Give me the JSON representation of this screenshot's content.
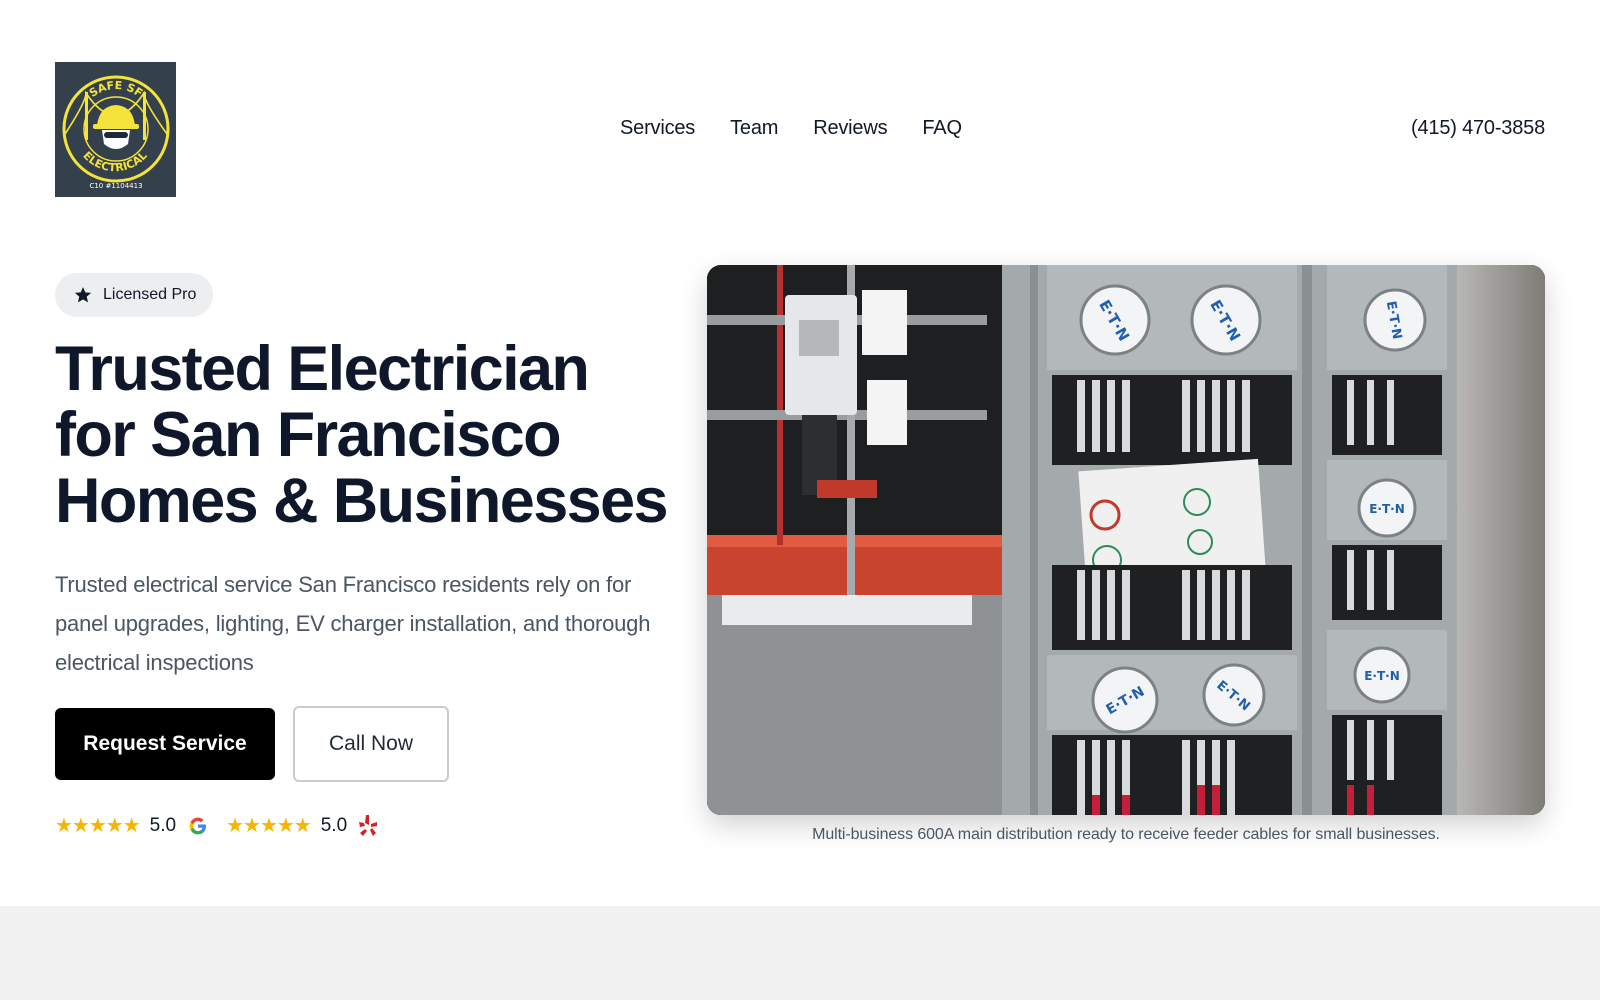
{
  "header": {
    "logo": {
      "top_text": "SAFE SF",
      "bottom_text": "ELECTRICAL",
      "license": "C10 #1104413"
    },
    "nav": [
      {
        "label": "Services"
      },
      {
        "label": "Team"
      },
      {
        "label": "Reviews"
      },
      {
        "label": "FAQ"
      }
    ],
    "phone": "(415) 470-3858"
  },
  "hero": {
    "badge": "Licensed Pro",
    "headline_lines": [
      "Trusted Electrician",
      "for San Francisco",
      "Homes & Businesses"
    ],
    "subtext": "Trusted electrical service San Francisco residents rely on for panel upgrades, lighting, EV charger installation, and thorough electrical inspections",
    "primary_button": "Request Service",
    "secondary_button": "Call Now",
    "ratings": [
      {
        "stars": "★★★★★",
        "score": "5.0",
        "source_icon": "google-icon"
      },
      {
        "stars": "★★★★★",
        "score": "5.0",
        "source_icon": "yelp-icon"
      }
    ],
    "image": {
      "caption": "Multi-business 600A main distribution ready to receive feeder cables for small businesses.",
      "meter_brand": "E·T·N"
    }
  },
  "colors": {
    "brand_dark": "#34414d",
    "logo_yellow": "#f5e23a",
    "primary_button": "#000000",
    "star_gold": "#f7b500",
    "badge_bg": "#eceef0",
    "band_bg": "#f1f1f1"
  }
}
